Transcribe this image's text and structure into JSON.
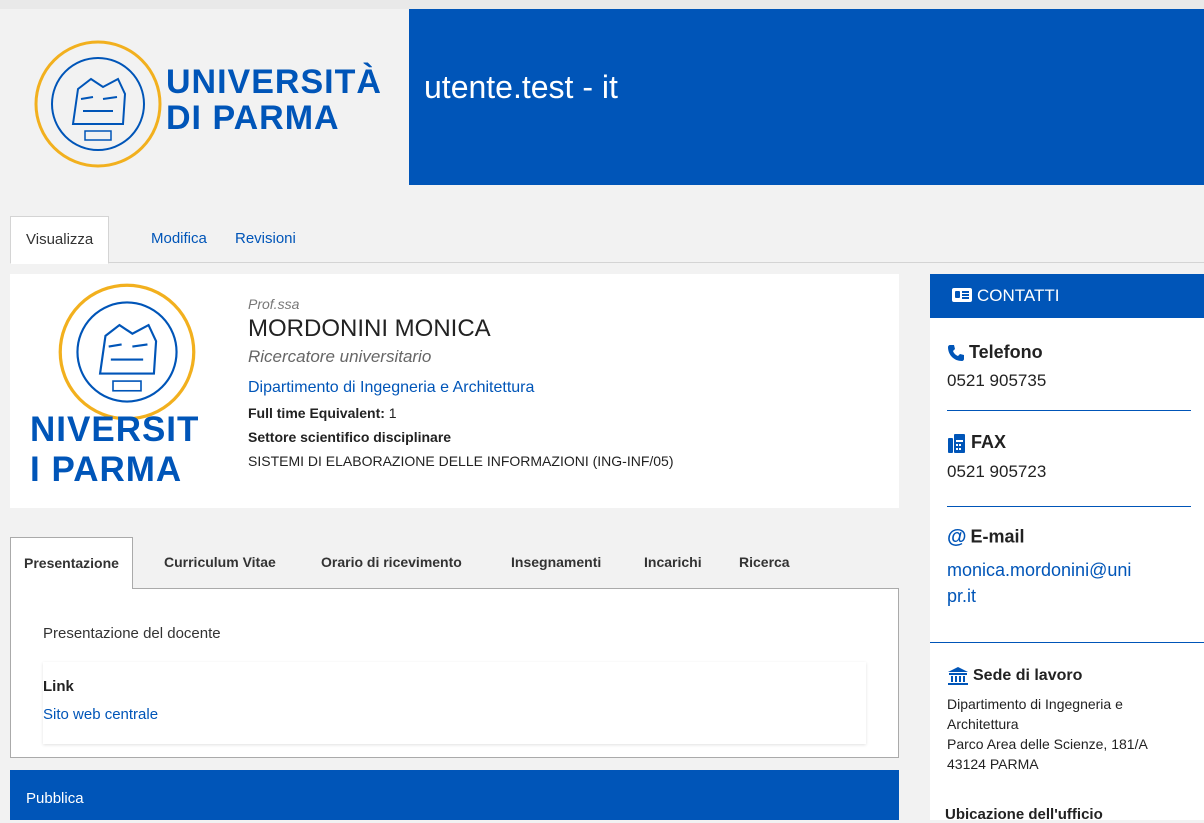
{
  "header": {
    "site_title": "utente.test - it",
    "logo_text": "UNIVERSITÀ DI PARMA",
    "logo_lines": [
      "UNIVERSITÀ",
      "DI PARMA"
    ]
  },
  "tabs": [
    {
      "label": "Visualizza",
      "active": true
    },
    {
      "label": "Modifica",
      "active": false
    },
    {
      "label": "Revisioni",
      "active": false
    }
  ],
  "profile": {
    "logo_lines": [
      "NIVERSIT",
      "I PARMA"
    ],
    "title": "Prof.ssa",
    "name": "MORDONINI MONICA",
    "role": "Ricercatore universitario",
    "department": "Dipartimento di Ingegneria e Architettura",
    "fte_label": "Full time Equivalent:",
    "fte_value": "1",
    "sector_label": "Settore scientifico disciplinare",
    "sector_value": "SISTEMI DI ELABORAZIONE DELLE INFORMAZIONI (ING-INF/05)"
  },
  "lower_tabs": [
    {
      "label": "Presentazione",
      "active": true
    },
    {
      "label": "Curriculum Vitae",
      "active": false
    },
    {
      "label": "Orario di ricevimento",
      "active": false
    },
    {
      "label": "Insegnamenti",
      "active": false
    },
    {
      "label": "Incarichi",
      "active": false
    },
    {
      "label": "Ricerca",
      "active": false
    }
  ],
  "presentation": {
    "title": "Presentazione del docente",
    "link_label": "Link",
    "link_text": "Sito web centrale"
  },
  "publish_bar": {
    "label": "Pubblica"
  },
  "contacts": {
    "header": "CONTATTI",
    "phone_label": "Telefono",
    "phone_value": "0521 905735",
    "fax_label": "FAX",
    "fax_value": "0521 905723",
    "email_label": "E-mail",
    "email_value_line1": "monica.mordonini@uni",
    "email_value_line2": "pr.it",
    "sede_label": "Sede di lavoro",
    "sede_line1": "Dipartimento di Ingegneria e",
    "sede_line2": "Architettura",
    "sede_line3": "Parco Area delle Scienze, 181/A",
    "sede_line4": "43124 PARMA",
    "ubicazione_label": "Ubicazione dell'ufficio"
  },
  "colors": {
    "brand_blue": "#0055b8",
    "background": "#f2f2f2"
  },
  "icons": [
    "university-seal-logo",
    "id-card-icon",
    "phone-icon",
    "fax-icon",
    "at-icon",
    "building-icon"
  ]
}
